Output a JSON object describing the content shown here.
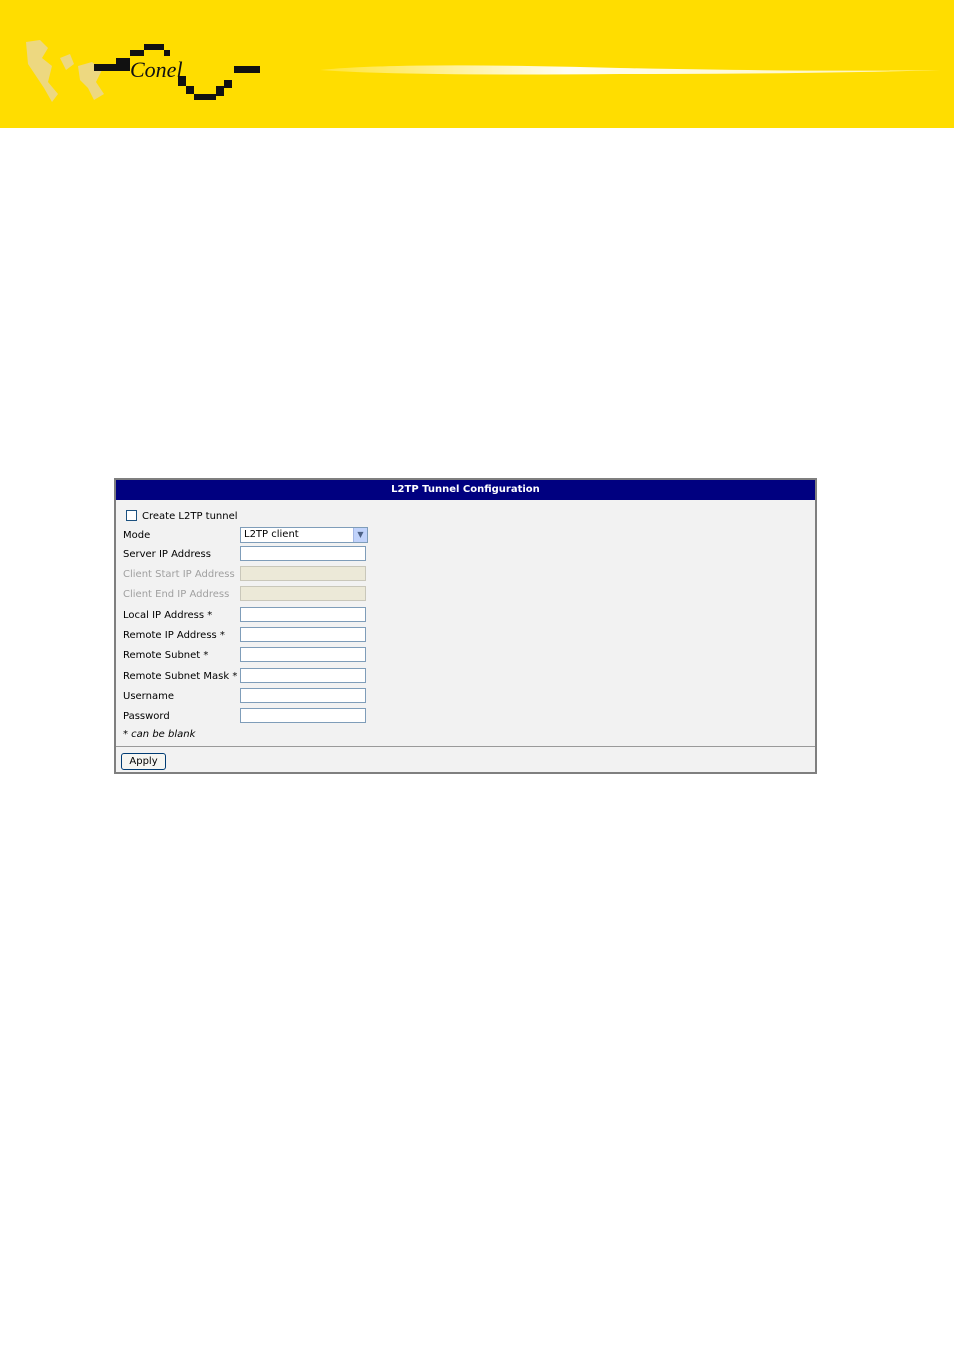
{
  "header": {
    "logo_text": "Conel",
    "brand_color": "#ffdd00"
  },
  "panel": {
    "title": "L2TP Tunnel Configuration",
    "header_color": "#000080",
    "create_checkbox": {
      "label": "Create L2TP tunnel",
      "checked": false
    },
    "mode": {
      "label": "Mode",
      "value": "L2TP client"
    },
    "fields": {
      "server_ip": {
        "label": "Server IP Address",
        "value": ""
      },
      "client_start_ip": {
        "label": "Client Start IP Address",
        "value": "",
        "disabled": true
      },
      "client_end_ip": {
        "label": "Client End IP Address",
        "value": "",
        "disabled": true
      },
      "local_ip": {
        "label": "Local IP Address *",
        "value": ""
      },
      "remote_ip": {
        "label": "Remote IP Address *",
        "value": ""
      },
      "remote_subnet": {
        "label": "Remote Subnet *",
        "value": ""
      },
      "remote_subnet_mask": {
        "label": "Remote Subnet Mask *",
        "value": ""
      },
      "username": {
        "label": "Username",
        "value": ""
      },
      "password": {
        "label": "Password",
        "value": ""
      }
    },
    "note": "* can be blank",
    "apply_label": "Apply"
  }
}
